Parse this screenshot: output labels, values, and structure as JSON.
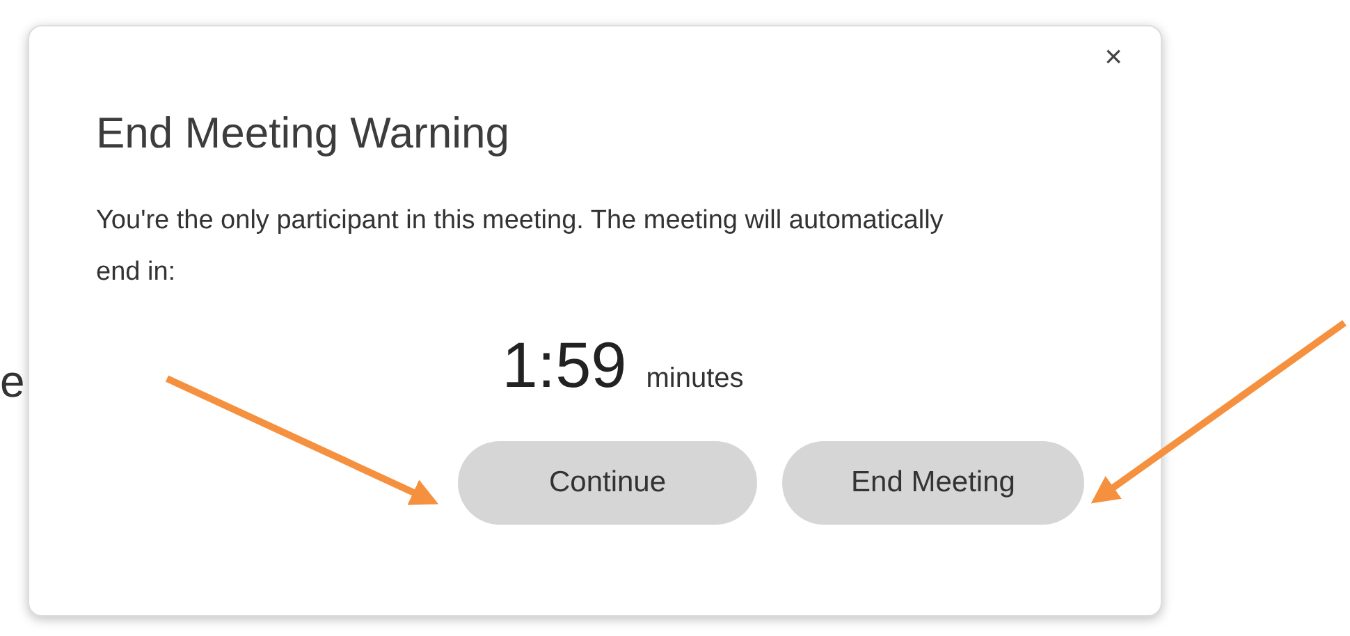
{
  "background_text": "e",
  "dialog": {
    "title": "End Meeting Warning",
    "close": "×",
    "message": "You're the only participant in this meeting. The meeting will automatically end in:",
    "countdown": "1:59",
    "unit": "minutes",
    "buttons": [
      {
        "label": "Continue"
      },
      {
        "label": "End Meeting"
      }
    ]
  }
}
